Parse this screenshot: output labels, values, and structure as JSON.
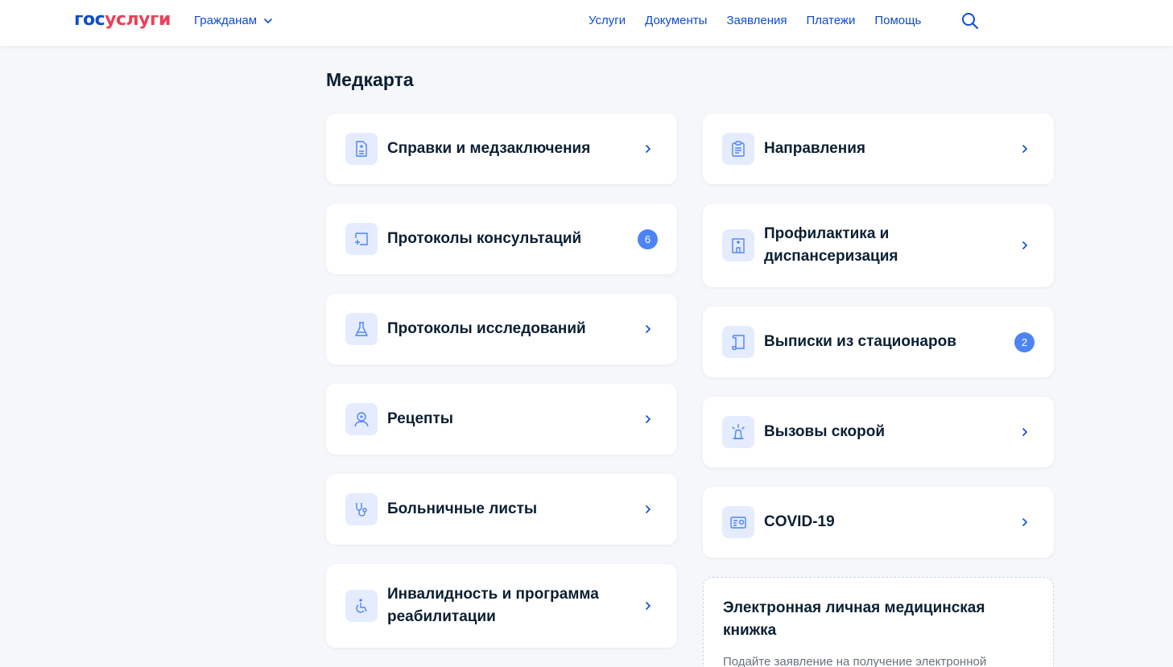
{
  "header": {
    "logo_part1": "гос",
    "logo_part2": "услуги",
    "audience": "Гражданам",
    "nav": [
      "Услуги",
      "Документы",
      "Заявления",
      "Платежи",
      "Помощь"
    ]
  },
  "page": {
    "title": "Медкарта"
  },
  "cards_left": [
    {
      "label": "Справки и медзаключения",
      "icon": "document-plus-icon",
      "badge": null
    },
    {
      "label": "Протоколы консультаций",
      "icon": "consultation-icon",
      "badge": "6"
    },
    {
      "label": "Протоколы исследований",
      "icon": "flask-icon",
      "badge": null
    },
    {
      "label": "Рецепты",
      "icon": "doctor-icon",
      "badge": null
    },
    {
      "label": "Больничные листы",
      "icon": "stethoscope-icon",
      "badge": null
    },
    {
      "label": "Инвалидность и программа реабилитации",
      "icon": "wheelchair-icon",
      "badge": null
    }
  ],
  "cards_right": [
    {
      "label": "Направления",
      "icon": "clipboard-icon",
      "badge": null
    },
    {
      "label": "Профилактика и диспансеризация",
      "icon": "hospital-icon",
      "badge": null
    },
    {
      "label": "Выписки из стационаров",
      "icon": "scroll-icon",
      "badge": "2"
    },
    {
      "label": "Вызовы скорой",
      "icon": "siren-icon",
      "badge": null
    },
    {
      "label": "COVID-19",
      "icon": "certificate-icon",
      "badge": null
    }
  ],
  "ehr": {
    "title": "Электронная личная медицинская книжка",
    "desc": "Подайте заявление на получение электронной"
  },
  "colors": {
    "brand_blue": "#0d4cd3",
    "brand_red": "#ee3f58",
    "badge": "#4d84f5",
    "icon_bg": "#e4ecfd"
  }
}
